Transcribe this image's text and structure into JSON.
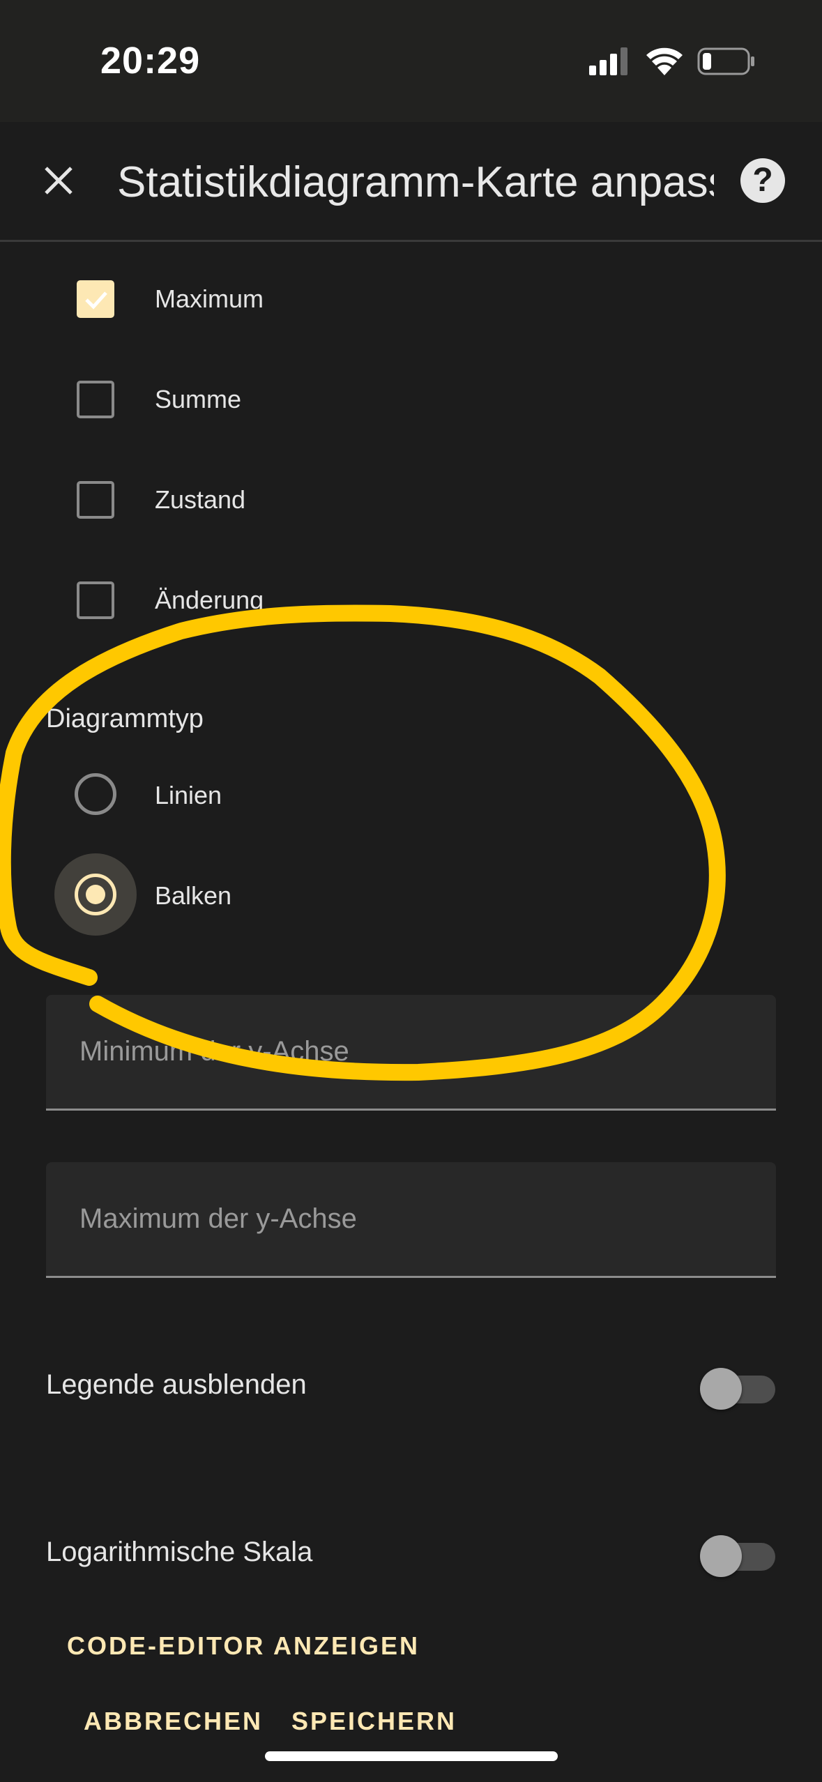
{
  "status_bar": {
    "time": "20:29",
    "icons": [
      "cellular-signal-icon",
      "wifi-icon",
      "battery-icon"
    ]
  },
  "app_bar": {
    "title": "Statistikdiagramm-Karte anpassen",
    "close_icon": "close-icon",
    "help_icon": "help-icon",
    "help_glyph": "?"
  },
  "stat_types": [
    {
      "label": "Maximum",
      "checked": true
    },
    {
      "label": "Summe",
      "checked": false
    },
    {
      "label": "Zustand",
      "checked": false
    },
    {
      "label": "Änderung",
      "checked": false
    }
  ],
  "chart_type": {
    "title": "Diagrammtyp",
    "options": [
      {
        "label": "Linien",
        "selected": false
      },
      {
        "label": "Balken",
        "selected": true
      }
    ]
  },
  "fields": {
    "y_min_placeholder": "Minimum der y-Achse",
    "y_max_placeholder": "Maximum der y-Achse"
  },
  "switches": {
    "hide_legend_label": "Legende ausblenden",
    "hide_legend_on": false,
    "log_scale_label": "Logarithmische Skala",
    "log_scale_on": false
  },
  "actions": {
    "code_editor": "CODE-EDITOR ANZEIGEN",
    "cancel": "ABBRECHEN",
    "save": "SPEICHERN"
  },
  "colors": {
    "background": "#1c1c1c",
    "accent": "#fde8b4",
    "annotation": "#ffc800"
  }
}
